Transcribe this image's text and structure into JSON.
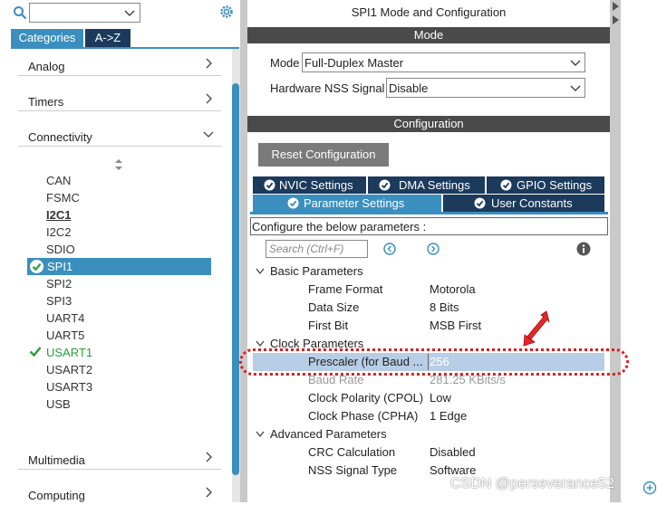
{
  "left": {
    "tabs": {
      "categories": "Categories",
      "az": "A->Z"
    },
    "categories": [
      {
        "label": "Analog",
        "arrow": ">"
      },
      {
        "label": "Timers",
        "arrow": ">"
      },
      {
        "label": "Connectivity",
        "arrow": "v"
      }
    ],
    "peripherals": [
      "CAN",
      "FSMC",
      "I2C1",
      "I2C2",
      "SDIO",
      "SPI1",
      "SPI2",
      "SPI3",
      "UART4",
      "UART5",
      "USART1",
      "USART2",
      "USART3",
      "USB"
    ],
    "bottom_categories": [
      {
        "label": "Multimedia"
      },
      {
        "label": "Computing"
      }
    ]
  },
  "right": {
    "title": "SPI1 Mode and Configuration",
    "mode_header": "Mode",
    "mode_label": "Mode",
    "mode_value": "Full-Duplex Master",
    "nss_label": "Hardware NSS Signal",
    "nss_value": "Disable",
    "config_header": "Configuration",
    "reset_button": "Reset Configuration",
    "tabs_row1": [
      "NVIC Settings",
      "DMA Settings",
      "GPIO Settings"
    ],
    "tabs_row2": [
      "Parameter Settings",
      "User Constants"
    ],
    "configure_text": "Configure the below parameters :",
    "search_placeholder": "Search (Ctrl+F)",
    "groups": {
      "basic": "Basic Parameters",
      "clock": "Clock Parameters",
      "advanced": "Advanced Parameters"
    },
    "params": [
      {
        "name": "Frame Format",
        "value": "Motorola"
      },
      {
        "name": "Data Size",
        "value": "8 Bits"
      },
      {
        "name": "First Bit",
        "value": "MSB First"
      },
      {
        "name": "Prescaler (for Baud ...",
        "value": "256"
      },
      {
        "name": "Baud Rate",
        "value": "281.25 KBits/s"
      },
      {
        "name": "Clock Polarity (CPOL)",
        "value": "Low"
      },
      {
        "name": "Clock Phase (CPHA)",
        "value": "1 Edge"
      },
      {
        "name": "CRC Calculation",
        "value": "Disabled"
      },
      {
        "name": "NSS Signal Type",
        "value": "Software"
      }
    ]
  },
  "watermark": "CSDN @perseverance52",
  "colors": {
    "accent": "#3a8fbf",
    "dark_tab": "#1b3a5c",
    "header": "#4a4a4a",
    "highlight": "#b8cde6",
    "annotation": "#d92020",
    "enabled": "#2a9d3a"
  }
}
